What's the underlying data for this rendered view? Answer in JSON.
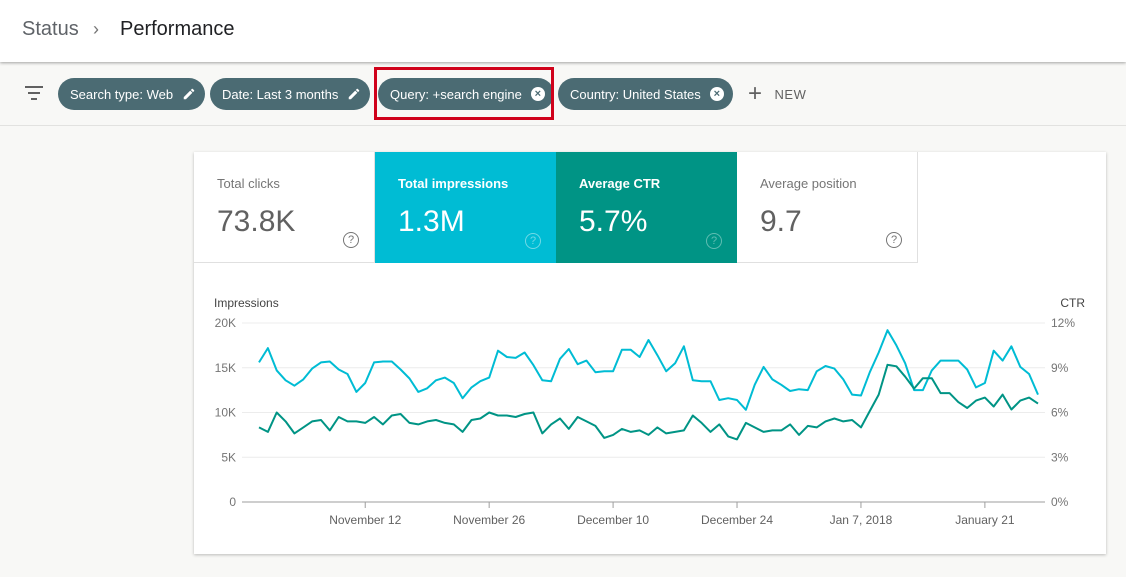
{
  "breadcrumb": {
    "parent": "Status",
    "separator": "›",
    "current": "Performance"
  },
  "filters": {
    "chips": [
      {
        "label": "Search type: Web",
        "icon": "pencil-icon"
      },
      {
        "label": "Date: Last 3 months",
        "icon": "pencil-icon"
      },
      {
        "label": "Query: +search engine",
        "icon": "close-circle-icon",
        "highlighted": true
      },
      {
        "label": "Country: United States",
        "icon": "close-circle-icon"
      }
    ],
    "new_label": "NEW"
  },
  "metrics": [
    {
      "label": "Total clicks",
      "value": "73.8K",
      "selected": false
    },
    {
      "label": "Total impressions",
      "value": "1.3M",
      "selected": true,
      "color": "#00bcd4"
    },
    {
      "label": "Average CTR",
      "value": "5.7%",
      "selected": true,
      "color": "#009485"
    },
    {
      "label": "Average position",
      "value": "9.7",
      "selected": false
    }
  ],
  "colors": {
    "impressions": "#00bcd4",
    "ctr": "#009485",
    "chip_bg": "#4b6b73",
    "highlight": "#d0021b"
  },
  "chart_data": {
    "type": "line",
    "left_axis_label": "Impressions",
    "right_axis_label": "CTR",
    "left_ticks": [
      "0",
      "5K",
      "10K",
      "15K",
      "20K"
    ],
    "right_ticks": [
      "0%",
      "3%",
      "6%",
      "9%",
      "12%"
    ],
    "ylim_left": [
      0,
      20000
    ],
    "ylim_right": [
      0,
      12
    ],
    "x_range": [
      "Oct 31, 2017",
      "Jan 27, 2018"
    ],
    "x_ticks": [
      {
        "label": "November 12",
        "day_index": 12
      },
      {
        "label": "November 26",
        "day_index": 26
      },
      {
        "label": "December 10",
        "day_index": 40
      },
      {
        "label": "December 24",
        "day_index": 54
      },
      {
        "label": "Jan 7, 2018",
        "day_index": 68
      },
      {
        "label": "January 21",
        "day_index": 82
      }
    ],
    "grid": true,
    "series": [
      {
        "name": "Impressions",
        "axis": "left",
        "values": [
          15600,
          17200,
          14700,
          13600,
          13000,
          13700,
          14900,
          15600,
          15700,
          14800,
          14300,
          12300,
          13300,
          15600,
          15700,
          15700,
          14800,
          13800,
          12300,
          12700,
          13600,
          13900,
          13300,
          11600,
          12800,
          13500,
          13900,
          16900,
          16200,
          16100,
          16700,
          15300,
          13600,
          13500,
          16000,
          17100,
          15400,
          15800,
          14500,
          14600,
          14600,
          17000,
          17000,
          16200,
          18100,
          16400,
          14600,
          15500,
          17400,
          13600,
          13500,
          13500,
          11400,
          11600,
          11400,
          10300,
          13100,
          15100,
          13700,
          13100,
          12400,
          12600,
          12500,
          14600,
          15200,
          14900,
          13700,
          12000,
          11900,
          14500,
          16700,
          19200,
          17500,
          15500,
          12500,
          12500,
          14700,
          15800,
          15800,
          15800,
          14800,
          12800,
          13300,
          16900,
          15800,
          17400,
          15100,
          14300,
          12000
        ]
      },
      {
        "name": "CTR",
        "axis": "right",
        "values": [
          5.0,
          4.7,
          6.0,
          5.4,
          4.6,
          5.0,
          5.4,
          5.5,
          4.8,
          5.7,
          5.4,
          5.4,
          5.3,
          5.7,
          5.2,
          5.8,
          5.9,
          5.3,
          5.2,
          5.4,
          5.5,
          5.3,
          5.2,
          4.7,
          5.5,
          5.6,
          6.0,
          5.8,
          5.8,
          5.7,
          5.9,
          6.0,
          4.6,
          5.2,
          5.6,
          4.9,
          5.7,
          5.4,
          5.1,
          4.3,
          4.5,
          4.9,
          4.7,
          4.8,
          4.5,
          5.0,
          4.6,
          4.7,
          4.8,
          5.8,
          5.3,
          4.7,
          5.2,
          4.4,
          4.2,
          5.3,
          5.0,
          4.7,
          4.8,
          4.8,
          5.2,
          4.5,
          5.1,
          5.0,
          5.4,
          5.6,
          5.4,
          5.5,
          5.0,
          6.1,
          7.2,
          9.2,
          9.1,
          8.4,
          7.6,
          8.3,
          8.3,
          7.3,
          7.3,
          6.7,
          6.3,
          6.8,
          7.0,
          6.4,
          7.2,
          6.2,
          6.8,
          7.0,
          6.6
        ]
      }
    ]
  }
}
